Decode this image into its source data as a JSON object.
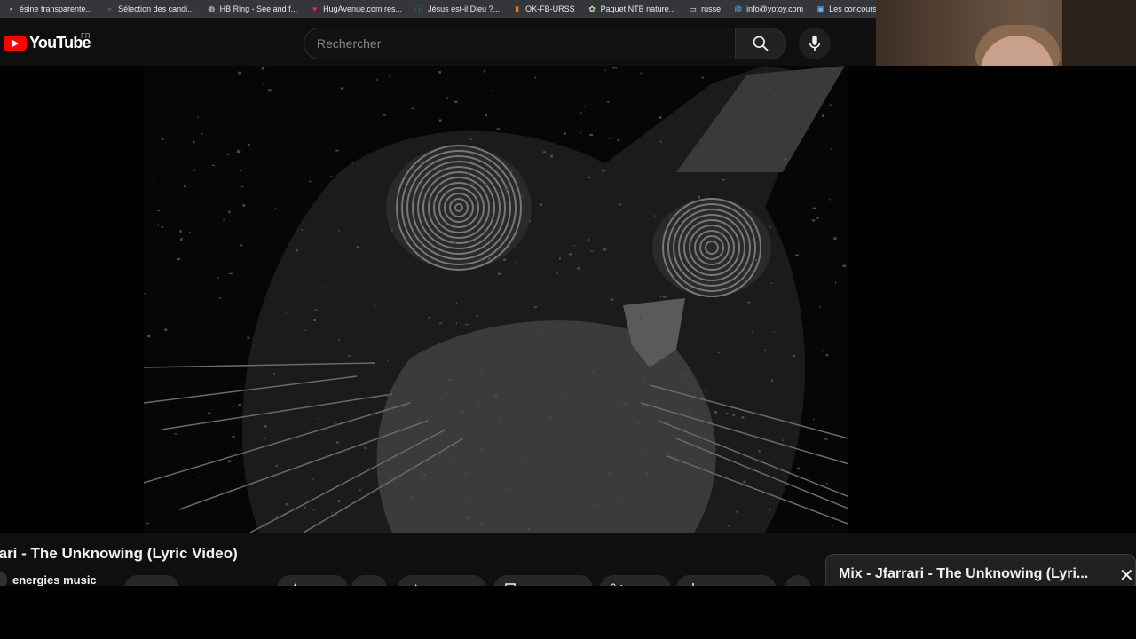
{
  "bookmarks": [
    {
      "label": "ésine transparente...",
      "icon": "generic-page-icon",
      "color": "#8ab4f8"
    },
    {
      "label": "Sélection des candi...",
      "icon": "file-icon",
      "color": "#9aa0a6"
    },
    {
      "label": "HB Ring - See and f...",
      "icon": "globe-icon",
      "color": "#e8eaed"
    },
    {
      "label": "HugAvenue.com res...",
      "icon": "heart-icon",
      "color": "#e91e63"
    },
    {
      "label": "Jésus est-il Dieu ?...",
      "icon": "info-icon",
      "color": "#1a73e8"
    },
    {
      "label": "OK-FB-URSS",
      "icon": "bookmark-icon",
      "color": "#f57c00"
    },
    {
      "label": "Paquet NTB nature...",
      "icon": "plant-icon",
      "color": "#c5e1a5"
    },
    {
      "label": "russe",
      "icon": "folder-icon",
      "color": "#e8eaed"
    },
    {
      "label": "info@yotoy.com",
      "icon": "at-icon",
      "color": "#4fc3f7"
    },
    {
      "label": "Les concours d'aute...",
      "icon": "image-icon",
      "color": "#64b5f6"
    }
  ],
  "header": {
    "logo_text": "YouTube",
    "country_code": "FR",
    "search_placeholder": "Rechercher"
  },
  "video": {
    "title": "rari - The Unknowing (Lyric Video)",
    "channel": "energies music"
  },
  "mix": {
    "title": "Mix - Jfarrari - The Unknowing (Lyri...",
    "close_symbol": "✕"
  },
  "colors": {
    "brand_red": "#ff0000",
    "background": "#0f0f0f"
  }
}
